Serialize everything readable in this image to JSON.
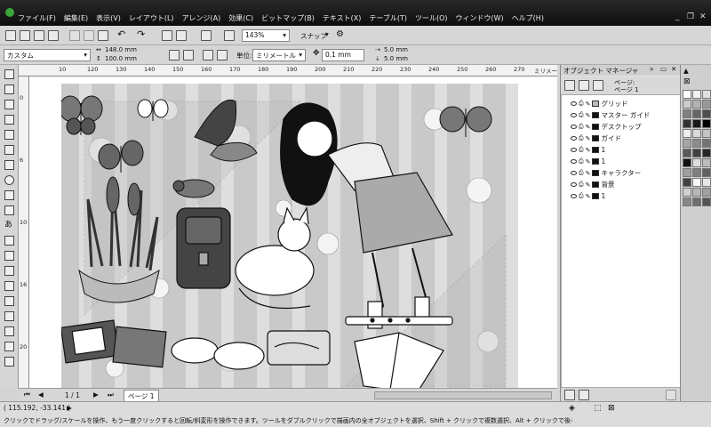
{
  "menubar": {
    "items": [
      "ファイル(F)",
      "編集(E)",
      "表示(V)",
      "レイアウト(L)",
      "アレンジ(A)",
      "効果(C)",
      "ビットマップ(B)",
      "テキスト(X)",
      "テーブル(T)",
      "ツール(O)",
      "ウィンドウ(W)",
      "ヘルプ(H)"
    ]
  },
  "toolbar1": {
    "zoom": "143%",
    "snap_label": "スナップ"
  },
  "toolbar2": {
    "preset": "カスタム",
    "width": "148.0 mm",
    "height": "100.0 mm",
    "units_label": "単位:",
    "units_value": "ミリメートル",
    "nudge": "0.1 mm",
    "dup_x": "5.0 mm",
    "dup_y": "5.0 mm"
  },
  "ruler": {
    "h_ticks": [
      "10",
      "120",
      "130",
      "140",
      "150",
      "160",
      "170",
      "180",
      "190",
      "200",
      "210",
      "220",
      "230",
      "240",
      "250",
      "260",
      "270"
    ],
    "unit": "ミリメートル",
    "v_ticks": [
      "0",
      "6",
      "10",
      "16",
      "20"
    ]
  },
  "pagebar": {
    "page_count": "1 / 1",
    "page_tab": "ページ 1"
  },
  "docker": {
    "title": "オブジェクト マネージャ",
    "page_header_1": "ページ:",
    "page_header_2": "ページ 1",
    "layers": [
      {
        "name": "グリッド",
        "color": "#bbbbbb"
      },
      {
        "name": "マスター ガイド",
        "color": "#111111"
      },
      {
        "name": "デスクトップ",
        "color": "#111111"
      },
      {
        "name": "ガイド",
        "color": "#111111"
      },
      {
        "name": "1",
        "color": "#111111"
      },
      {
        "name": "1",
        "color": "#111111"
      },
      {
        "name": "キャラクター",
        "color": "#111111"
      },
      {
        "name": "背景",
        "color": "#111111"
      },
      {
        "name": "1",
        "color": "#111111"
      }
    ]
  },
  "palette": {
    "colors": [
      "#ffffff",
      "#f2f2f2",
      "#e0e0e0",
      "#cccccc",
      "#b3b3b3",
      "#999999",
      "#808080",
      "#666666",
      "#4d4d4d",
      "#333333",
      "#1a1a1a",
      "#000000",
      "#eeeeee",
      "#d9d9d9",
      "#c4c4c4",
      "#a6a6a6",
      "#8c8c8c",
      "#737373",
      "#595959",
      "#404040",
      "#262626",
      "#111111",
      "#dddddd",
      "#bdbdbd",
      "#9e9e9e",
      "#7f7f7f",
      "#616161",
      "#424242",
      "#f7f7f7",
      "#e6e6e6",
      "#d1d1d1",
      "#b8b8b8",
      "#a0a0a0",
      "#878787",
      "#6e6e6e",
      "#555555"
    ]
  },
  "status": {
    "coords": "( 115.192, -33.141 )",
    "hint": "クリックでドラッグ/スケールを操作、もう一度クリックすると回転/斜変形を操作できます。ツールをダブルクリックで描画内の全オブジェクトを選択、Shift + クリックで複数選択、Alt + クリックで後ろに隠れたオブジェクトを選択。"
  }
}
